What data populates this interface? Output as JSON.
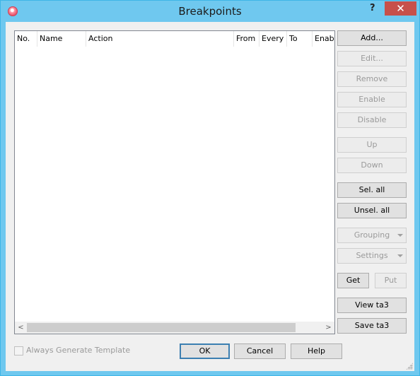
{
  "window": {
    "title": "Breakpoints",
    "help_label": "?",
    "close_label": "✕"
  },
  "list": {
    "columns": [
      "No.",
      "Name",
      "Action",
      "From",
      "Every",
      "To",
      "Enab"
    ],
    "scroll_left": "<",
    "scroll_right": ">"
  },
  "side_buttons": {
    "add": "Add...",
    "edit": "Edit...",
    "remove": "Remove",
    "enable": "Enable",
    "disable": "Disable",
    "up": "Up",
    "down": "Down",
    "sel_all": "Sel. all",
    "unsel_all": "Unsel. all",
    "grouping": "Grouping",
    "settings": "Settings",
    "get": "Get",
    "put": "Put",
    "view_ta3": "View ta3",
    "save_ta3": "Save ta3"
  },
  "footer": {
    "always_generate": "Always Generate Template",
    "always_generate_checked": false,
    "ok": "OK",
    "cancel": "Cancel",
    "help": "Help"
  }
}
